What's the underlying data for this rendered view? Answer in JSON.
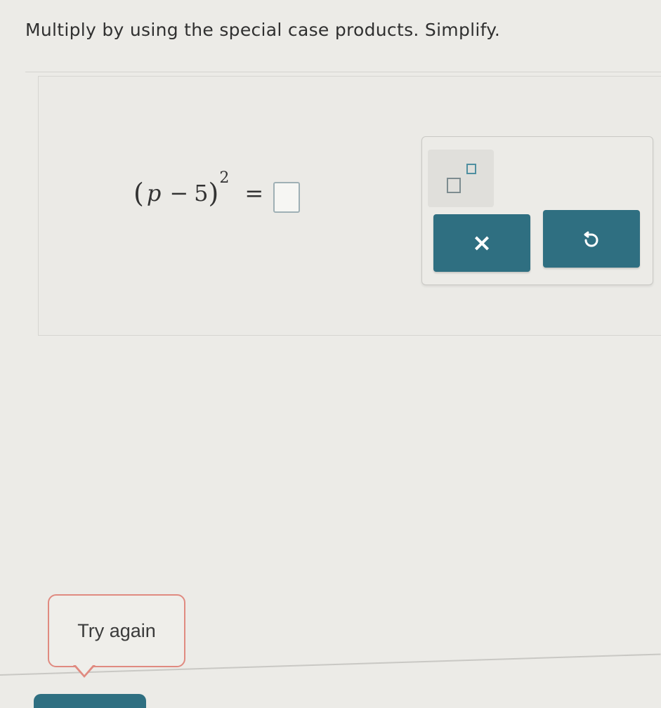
{
  "instructions": "Multiply by using the special case products. Simplify.",
  "equation": {
    "open_paren": "(",
    "variable": "p",
    "operator": "−",
    "constant": "5",
    "close_paren": ")",
    "exponent": "2",
    "equals": "="
  },
  "keypad": {
    "exponent_button_icon": "exponent-template-icon",
    "clear_button_label": "×",
    "clear_button_icon": "close-icon",
    "undo_button_icon": "undo-icon",
    "button_color": "#2f6f81"
  },
  "feedback": {
    "message": "Try again",
    "border_color": "#e08a80"
  }
}
